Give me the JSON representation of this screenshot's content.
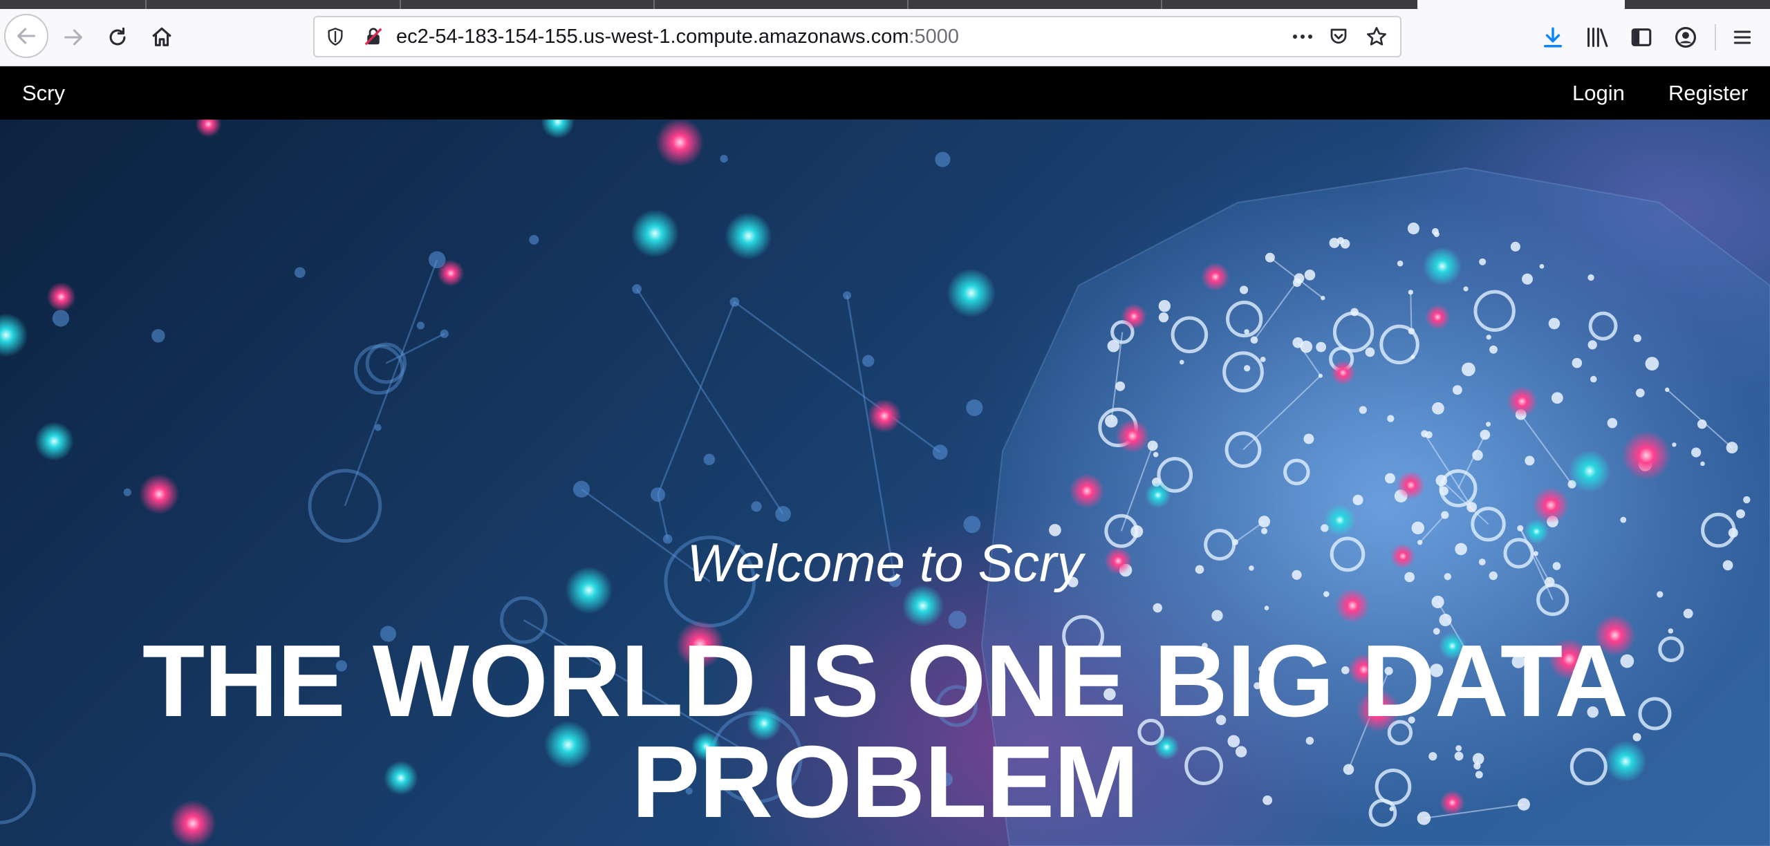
{
  "browser": {
    "url_host": "ec2-54-183-154-155.us-west-1.compute.amazonaws.com",
    "url_port": ":5000",
    "icons": [
      "back-arrow-icon",
      "forward-arrow-icon",
      "reload-icon",
      "home-icon",
      "shield-icon",
      "insecure-lock-icon",
      "more-icon",
      "pocket-icon",
      "star-icon",
      "download-icon",
      "library-icon",
      "sidebar-icon",
      "account-icon",
      "menu-icon"
    ],
    "accent_color": "#0a84ff"
  },
  "site": {
    "brand": "Scry",
    "nav": {
      "login": "Login",
      "register": "Register"
    }
  },
  "hero": {
    "welcome": "Welcome to Scry",
    "headline": "THE WORLD IS ONE BIG DATA PROBLEM"
  }
}
